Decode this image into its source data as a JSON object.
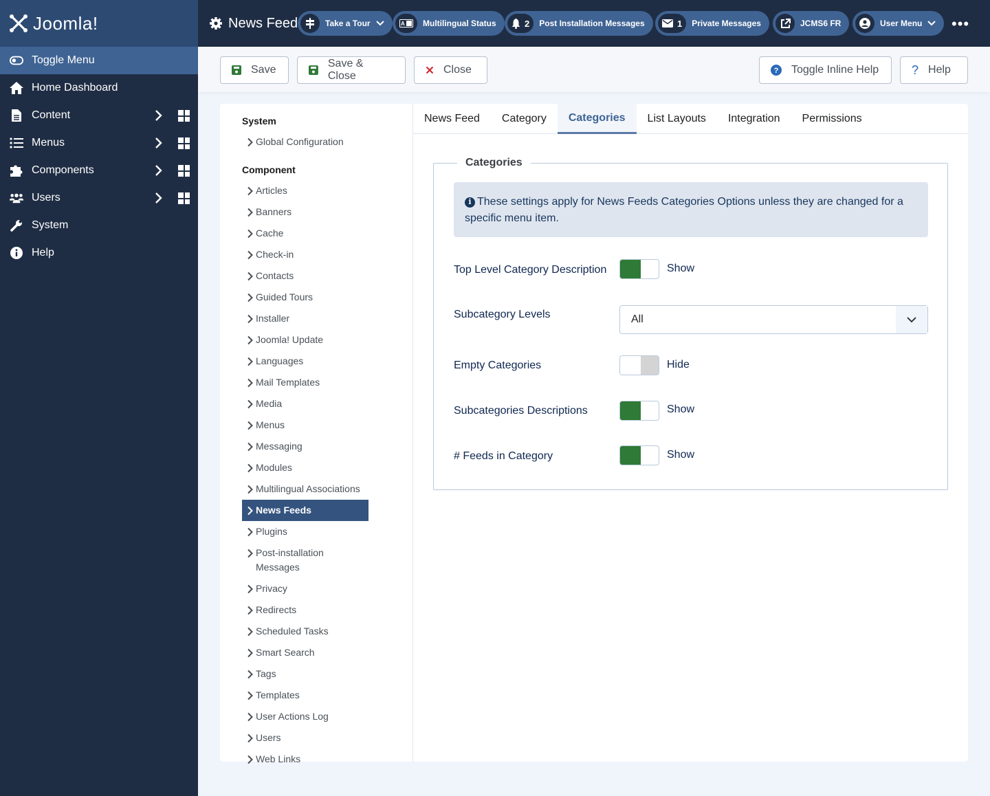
{
  "header": {
    "brand": "Joomla!",
    "page_title": "News Feed:",
    "pills": [
      {
        "icon": "signpost-icon",
        "label": "Take a Tour",
        "has_dropdown": true
      },
      {
        "icon": "language-icon",
        "label": "Multilingual Status"
      },
      {
        "icon": "bell-icon",
        "count": "2",
        "label": "Post Installation Messages"
      },
      {
        "icon": "envelope-icon",
        "count": "1",
        "label": "Private Messages"
      },
      {
        "icon": "external-link-icon",
        "label": "JCMS6 FR"
      },
      {
        "icon": "user-circle-icon",
        "label": "User Menu",
        "has_dropdown": true
      }
    ],
    "more_label": "•••"
  },
  "sidebar": {
    "toggle_label": "Toggle Menu",
    "items": [
      {
        "label": "Home Dashboard",
        "icon": "home-icon"
      },
      {
        "label": "Content",
        "icon": "file-icon",
        "submenu": true
      },
      {
        "label": "Menus",
        "icon": "list-icon",
        "submenu": true
      },
      {
        "label": "Components",
        "icon": "puzzle-icon",
        "submenu": true
      },
      {
        "label": "Users",
        "icon": "users-icon",
        "submenu": true
      },
      {
        "label": "System",
        "icon": "wrench-icon"
      },
      {
        "label": "Help",
        "icon": "info-icon"
      }
    ]
  },
  "toolbar": {
    "save": "Save",
    "save_close": "Save & Close",
    "close": "Close",
    "toggle_inline_help": "Toggle Inline Help",
    "help": "Help"
  },
  "options_nav": {
    "system_heading": "System",
    "system_items": [
      "Global Configuration"
    ],
    "component_heading": "Component",
    "component_items": [
      "Articles",
      "Banners",
      "Cache",
      "Check-in",
      "Contacts",
      "Guided Tours",
      "Installer",
      "Joomla! Update",
      "Languages",
      "Mail Templates",
      "Media",
      "Menus",
      "Messaging",
      "Modules",
      "Multilingual Associations",
      "News Feeds",
      "Plugins",
      "Post-installation Messages",
      "Privacy",
      "Redirects",
      "Scheduled Tasks",
      "Smart Search",
      "Tags",
      "Templates",
      "User Actions Log",
      "Users",
      "Web Links"
    ],
    "active_item": "News Feeds"
  },
  "tabs": {
    "items": [
      "News Feed",
      "Category",
      "Categories",
      "List Layouts",
      "Integration",
      "Permissions"
    ],
    "active": "Categories"
  },
  "form": {
    "legend": "Categories",
    "info": "These settings apply for News Feeds Categories Options unless they are changed for a specific menu item.",
    "fields": [
      {
        "label": "Top Level Category Description",
        "type": "switch",
        "value": "Show",
        "on": true
      },
      {
        "label": "Subcategory Levels",
        "type": "select",
        "value": "All"
      },
      {
        "label": "Empty Categories",
        "type": "switch",
        "value": "Hide",
        "on": false
      },
      {
        "label": "Subcategories Descriptions",
        "type": "switch",
        "value": "Show",
        "on": true
      },
      {
        "label": "# Feeds in Category",
        "type": "switch",
        "value": "Show",
        "on": true
      }
    ]
  },
  "colors": {
    "header_bg": "#1f2d44",
    "brand_bg": "#2d4a73",
    "pill_bg": "#3f6393",
    "active_nav": "#34547f",
    "switch_on": "#2e7a36",
    "save_icon": "#2e7a36",
    "close_icon": "#d0242b",
    "help_icon": "#2a69b8"
  }
}
